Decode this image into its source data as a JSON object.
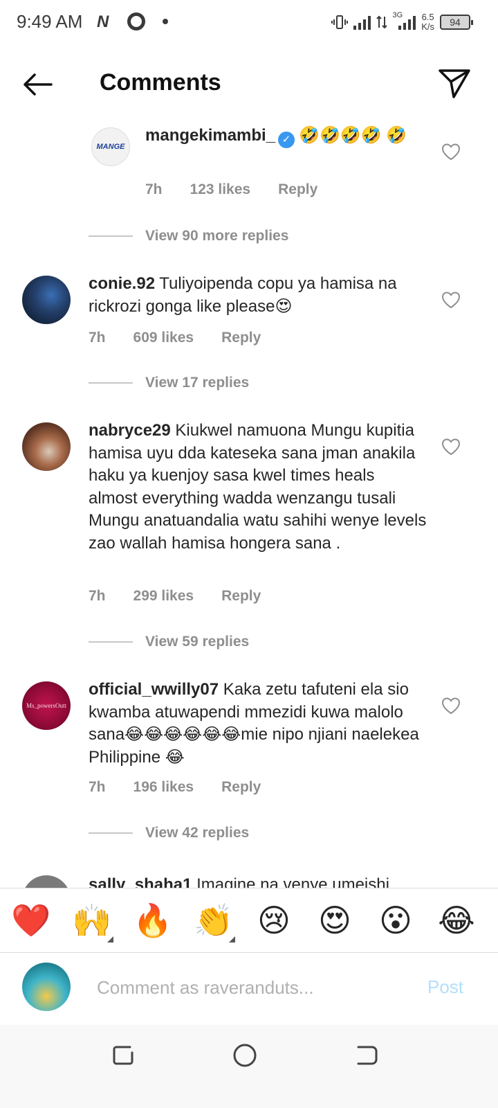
{
  "status_bar": {
    "time": "9:49 AM",
    "network_type": "3G",
    "speed_value": "6.5",
    "speed_unit": "K/s",
    "battery": "94"
  },
  "header": {
    "title": "Comments"
  },
  "comments": [
    {
      "username": "mangekimambi_",
      "verified": true,
      "text": "🤣🤣🤣🤣 🤣",
      "time": "7h",
      "likes": "123 likes",
      "reply_label": "Reply",
      "view_replies": "View 90 more replies",
      "avatar_text": "MANGE"
    },
    {
      "username": "conie.92",
      "text": "Tuliyoipenda copu ya hamisa na rickrozi gonga like please😍",
      "time": "7h",
      "likes": "609 likes",
      "reply_label": "Reply",
      "view_replies": "View 17 replies"
    },
    {
      "username": "nabryce29",
      "text": "Kiukwel namuona Mungu kupitia hamisa uyu dda kateseka sana jman anakila haku ya kuenjoy sasa kwel times heals almost everything wadda wenzangu tusali Mungu anatuandalia watu sahihi wenye levels zao wallah hamisa hongera sana .",
      "time": "7h",
      "likes": "299 likes",
      "reply_label": "Reply",
      "view_replies": "View 59 replies"
    },
    {
      "username": "official_wwilly07",
      "text": "Kaka zetu tafuteni ela sio kwamba atuwapendi mmezidi kuwa malolo  sana😂😂😂😂😂😂mie nipo njiani naelekea Philippine 😂",
      "time": "7h",
      "likes": "196 likes",
      "reply_label": "Reply",
      "view_replies": "View 42 replies",
      "avatar_text": "Ms_powersOutt"
    }
  ],
  "partial_comment": {
    "username": "sally_shaha1",
    "text": "Imagine na venye umeishi"
  },
  "emoji_bar": [
    "❤️",
    "🙌",
    "🔥",
    "👏",
    "😢",
    "😍",
    "😮",
    "😂"
  ],
  "comment_input": {
    "placeholder": "Comment as raveranduts...",
    "post_label": "Post"
  },
  "colors": {
    "verified_blue": "#3897f0",
    "post_disabled": "#b2dffc",
    "meta_gray": "#8e8e8e"
  }
}
